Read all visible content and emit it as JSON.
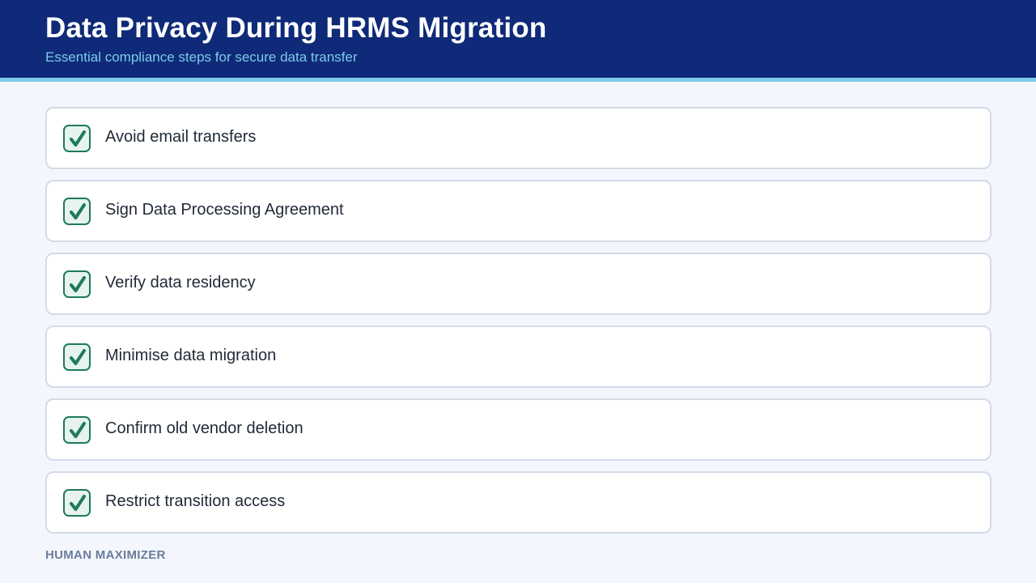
{
  "header": {
    "title": "Data Privacy During HRMS Migration",
    "subtitle": "Essential compliance steps for secure data transfer"
  },
  "checklist": {
    "items": [
      {
        "label": "Avoid email transfers",
        "checked": true
      },
      {
        "label": "Sign Data Processing Agreement",
        "checked": true
      },
      {
        "label": "Verify data residency",
        "checked": true
      },
      {
        "label": "Minimise data migration",
        "checked": true
      },
      {
        "label": "Confirm old vendor deletion",
        "checked": true
      },
      {
        "label": "Restrict transition access",
        "checked": true
      }
    ]
  },
  "footer": {
    "brand": "HUMAN MAXIMIZER"
  },
  "colors": {
    "header_bg": "#0f2a78",
    "accent": "#7ccbe9",
    "check_green": "#1f7a5a",
    "page_bg": "#f3f7fd"
  },
  "icons": {
    "item_icon": "checkmark-icon"
  }
}
